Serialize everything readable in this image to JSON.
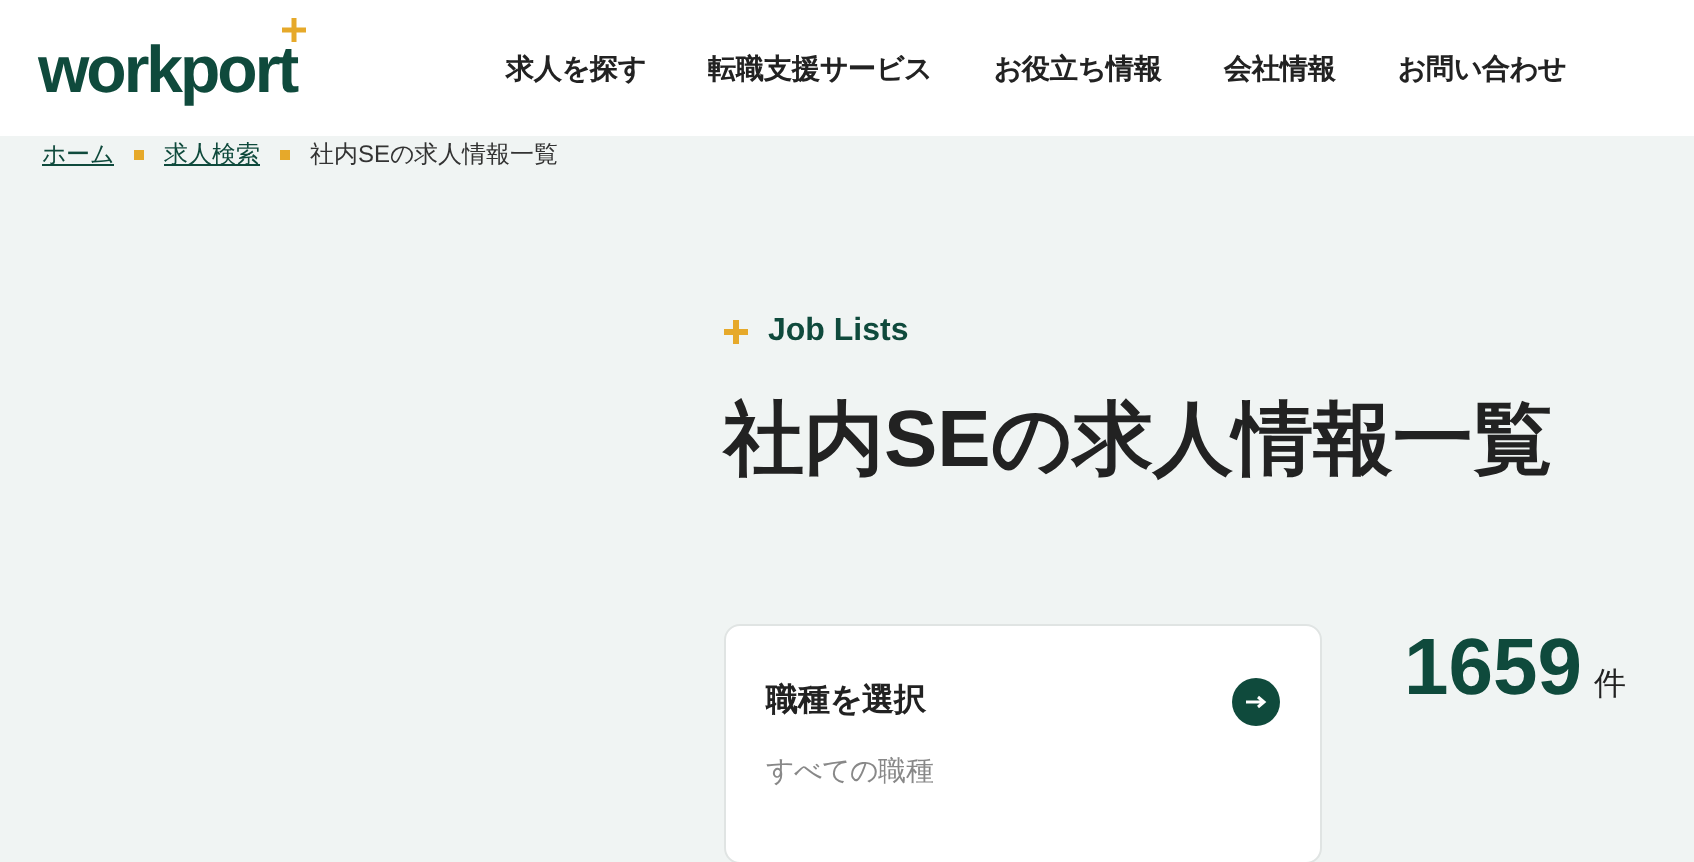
{
  "logo": "workport",
  "nav": [
    "求人を探す",
    "転職支援サービス",
    "お役立ち情報",
    "会社情報",
    "お問い合わせ"
  ],
  "breadcrumb": [
    {
      "label": "ホーム",
      "link": true
    },
    {
      "label": "求人検索",
      "link": true
    },
    {
      "label": "社内SEの求人情報一覧",
      "link": false
    }
  ],
  "eyebrow": "Job Lists",
  "title": "社内SEの求人情報一覧",
  "filter_card": {
    "label": "職種を選択",
    "value": "すべての職種"
  },
  "count": {
    "number": "1659",
    "unit": "件"
  }
}
